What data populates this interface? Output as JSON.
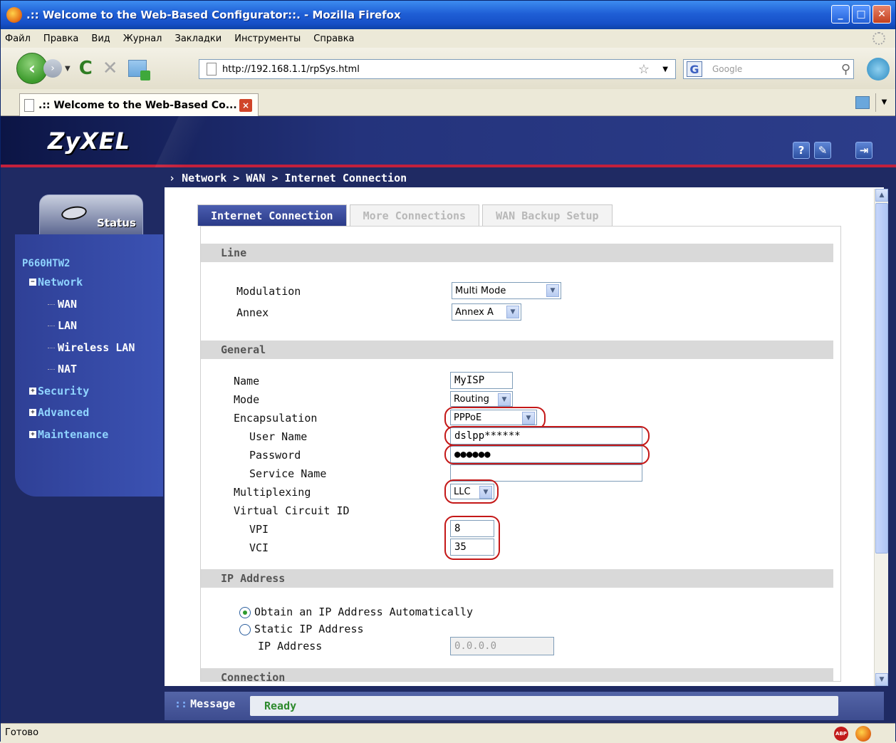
{
  "window": {
    "title": ".:: Welcome to the Web-Based Configurator::. - Mozilla Firefox"
  },
  "menu": [
    "Файл",
    "Правка",
    "Вид",
    "Журнал",
    "Закладки",
    "Инструменты",
    "Справка"
  ],
  "nav": {
    "url": "http://192.168.1.1/rpSys.html",
    "search_placeholder": "Google"
  },
  "tab": {
    "title": ".:: Welcome to the Web-Based Co..."
  },
  "brand": {
    "logo": "ZyXEL"
  },
  "breadcrumb": "Network > WAN > Internet Connection",
  "sidebar": {
    "status_label": "Status",
    "device": "P660HTW2",
    "groups": [
      {
        "label": "Network",
        "expanded": true,
        "items": [
          "WAN",
          "LAN",
          "Wireless LAN",
          "NAT"
        ]
      },
      {
        "label": "Security",
        "expanded": false
      },
      {
        "label": "Advanced",
        "expanded": false
      },
      {
        "label": "Maintenance",
        "expanded": false
      }
    ]
  },
  "tabs": [
    "Internet Connection",
    "More Connections",
    "WAN Backup Setup"
  ],
  "sections": {
    "line": "Line",
    "general": "General",
    "ip": "IP Address",
    "connection": "Connection"
  },
  "line": {
    "modulation_label": "Modulation",
    "modulation_value": "Multi Mode",
    "annex_label": "Annex",
    "annex_value": "Annex A"
  },
  "general": {
    "name_label": "Name",
    "name_value": "MyISP",
    "mode_label": "Mode",
    "mode_value": "Routing",
    "encap_label": "Encapsulation",
    "encap_value": "PPPoE",
    "user_label": "User Name",
    "user_value": "dslpp******",
    "pass_label": "Password",
    "pass_value": "●●●●●●",
    "service_label": "Service Name",
    "service_value": "",
    "mux_label": "Multiplexing",
    "mux_value": "LLC",
    "vc_label": "Virtual Circuit ID",
    "vpi_label": "VPI",
    "vpi_value": "8",
    "vci_label": "VCI",
    "vci_value": "35"
  },
  "ip": {
    "auto_label": "Obtain an IP Address Automatically",
    "static_label": "Static IP Address",
    "addr_label": "IP Address",
    "addr_value": "0.0.0.0",
    "selected": "auto"
  },
  "message": {
    "label": "Message",
    "value": "Ready"
  },
  "statusbar": {
    "text": "Готово"
  },
  "colors": {
    "highlight": "#c41818",
    "accent": "#2a3a88",
    "ready": "#2d8a2d"
  }
}
